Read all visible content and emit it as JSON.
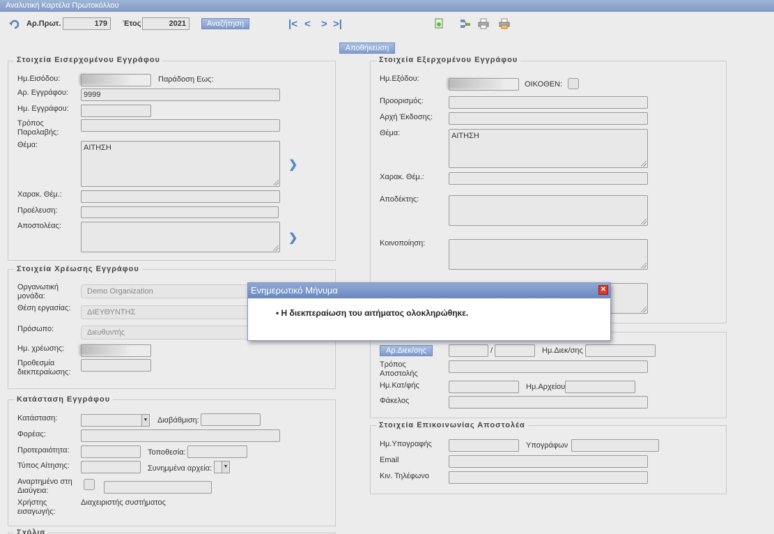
{
  "window": {
    "title": "Αναλυτική Καρτέλα Πρωτοκόλλου"
  },
  "toolbar": {
    "ar_prot_label": "Αρ.Πρωτ.",
    "ar_prot_value": "179",
    "year_label": "Έτος",
    "year_value": "2021",
    "search_label": "Αναζήτηση",
    "save_label": "Αποθήκευση"
  },
  "incoming": {
    "legend": "Στοιχεία Εισερχομένου Εγγράφου",
    "entry_date_label": "Ημ.Εισόδου:",
    "handover_until_label": "Παράδοση Εως:",
    "doc_number_label": "Αρ. Εγγράφου:",
    "doc_number_value": "9999",
    "doc_date_label": "Ημ. Εγγράφου:",
    "receipt_mode_label": "Τρόπος Παραλαβής:",
    "subject_label": "Θέμα:",
    "subject_value": "ΑΙΤΗΣΗ",
    "subject_char_label": "Χαρακ. Θέμ.:",
    "origin_label": "Προέλευση:",
    "sender_label": "Αποστολέας:"
  },
  "outgoing": {
    "legend": "Στοιχεία Εξερχομένου Εγγράφου",
    "exit_date_label": "Ημ.Εξόδου:",
    "self_label": "ΟΙΚΟΘΕΝ:",
    "destination_label": "Προορισμός:",
    "issuing_auth_label": "Αρχή Έκδοσης:",
    "subject_label": "Θέμα:",
    "subject_value": "ΑΙΤΗΣΗ",
    "subject_char_label": "Χαρακ. Θέμ.:",
    "recipient_label": "Αποδέκτης:",
    "notification_label": "Κοινοποίηση:"
  },
  "charge": {
    "legend": "Στοιχεία Χρέωσης Εγγράφου",
    "org_unit_label": "Οργανωτική μονάδα:",
    "org_unit_value": "Demo Organization",
    "position_label": "Θέση εργασίας:",
    "position_value": "ΔΙΕΥΘΥΝΤΗΣ",
    "person_label": "Πρόσωπο:",
    "person_value": "Διευθυντής",
    "charge_date_label": "Ημ. χρέωσης:",
    "deadline_label": "Προθεσμία διεκπεραίωσης:"
  },
  "status": {
    "legend": "Κατάσταση Εγγράφου",
    "state_label": "Κατάσταση:",
    "grading_label": "Διαβάθμιση:",
    "body_label": "Φορέας:",
    "priority_label": "Προτεραιότητα:",
    "location_label": "Τοποθεσία:",
    "request_type_label": "Τύπος Αίτησης:",
    "attachments_label": "Συνημμένα αρχεία:",
    "posted_label": "Αναρτημένο στη Διαύγεια:",
    "input_user_label": "Χρήστης εισαγωγής:",
    "input_user_value": "Διαχειριστής συστήματος"
  },
  "comments": {
    "legend": "Σχόλια"
  },
  "dispatch": {
    "ar_diek_button": "Αρ.Διεκ/σης",
    "slash": "/",
    "diek_date_label": "Ημ.Διεκ/σης",
    "send_mode_label": "Τρόπος Αποστολής",
    "kat_date_label": "Ημ.Κατ/φής",
    "archive_date_label": "Ημ.Αρχείου",
    "folder_label": "Φάκελος"
  },
  "contact": {
    "legend": "Στοιχεία Επικοινωνίας Αποστολέα",
    "signature_date_label": "Ημ.Υπογραφής",
    "signers_label": "Υπογράφων",
    "email_label": "Email",
    "mobile_label": "Κιν. Τηλέφωνο"
  },
  "dialog": {
    "title": "Ενημερωτικό Μήνυμα",
    "message": "Η διεκπεραίωση του αιτήματος ολοκληρώθηκε."
  },
  "colors": {
    "title_bar": "#8fa7d4",
    "button": "#819ccc",
    "close": "#d63a2a",
    "background": "#ececec"
  }
}
